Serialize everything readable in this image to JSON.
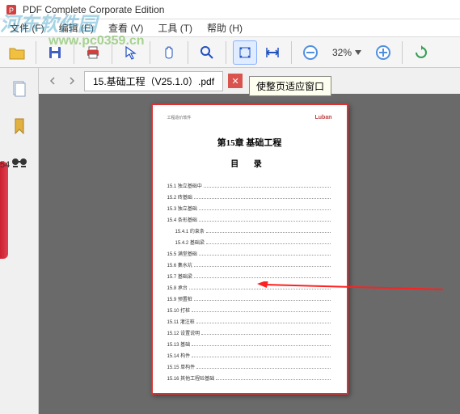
{
  "titlebar": {
    "text": "PDF Complete Corporate Edition"
  },
  "menubar": {
    "items": [
      "文件 (F)",
      "编辑 (E)",
      "查看 (V)",
      "工具 (T)",
      "帮助 (H)"
    ]
  },
  "watermark": {
    "main": "河东软件园",
    "sub": "www.pc0359.cn"
  },
  "toolbar": {
    "zoom_value": "32%"
  },
  "tab": {
    "filename": "15.基础工程（V25.1.0）.pdf"
  },
  "tooltip": {
    "text": "使整页适应窗口"
  },
  "page": {
    "header_left": "工程造价软件",
    "header_right": "Luban",
    "title": "第15章 基础工程",
    "subtitle": "目 录",
    "toc": [
      {
        "label": "15.1 独立基础中",
        "indent": false
      },
      {
        "label": "15.2 砖基础",
        "indent": false
      },
      {
        "label": "15.3 独立基础",
        "indent": false
      },
      {
        "label": "15.4 条形基础",
        "indent": false
      },
      {
        "label": "15.4.1 约束条",
        "indent": true
      },
      {
        "label": "15.4.2 基础梁",
        "indent": true
      },
      {
        "label": "15.5 满堂基础",
        "indent": false
      },
      {
        "label": "15.6 集水坑",
        "indent": false
      },
      {
        "label": "15.7 基础梁",
        "indent": false
      },
      {
        "label": "15.8 承台",
        "indent": false
      },
      {
        "label": "15.9 预置桩",
        "indent": false
      },
      {
        "label": "15.10 打桩",
        "indent": false
      },
      {
        "label": "15.11 灌注桩",
        "indent": false
      },
      {
        "label": "15.12 设置说明",
        "indent": false
      },
      {
        "label": "15.13 基础",
        "indent": false
      },
      {
        "label": "15.14 构件",
        "indent": false
      },
      {
        "label": "15.15 单构件",
        "indent": false
      },
      {
        "label": "15.16 其他工程砼基础",
        "indent": false
      }
    ]
  },
  "left_num": "54"
}
